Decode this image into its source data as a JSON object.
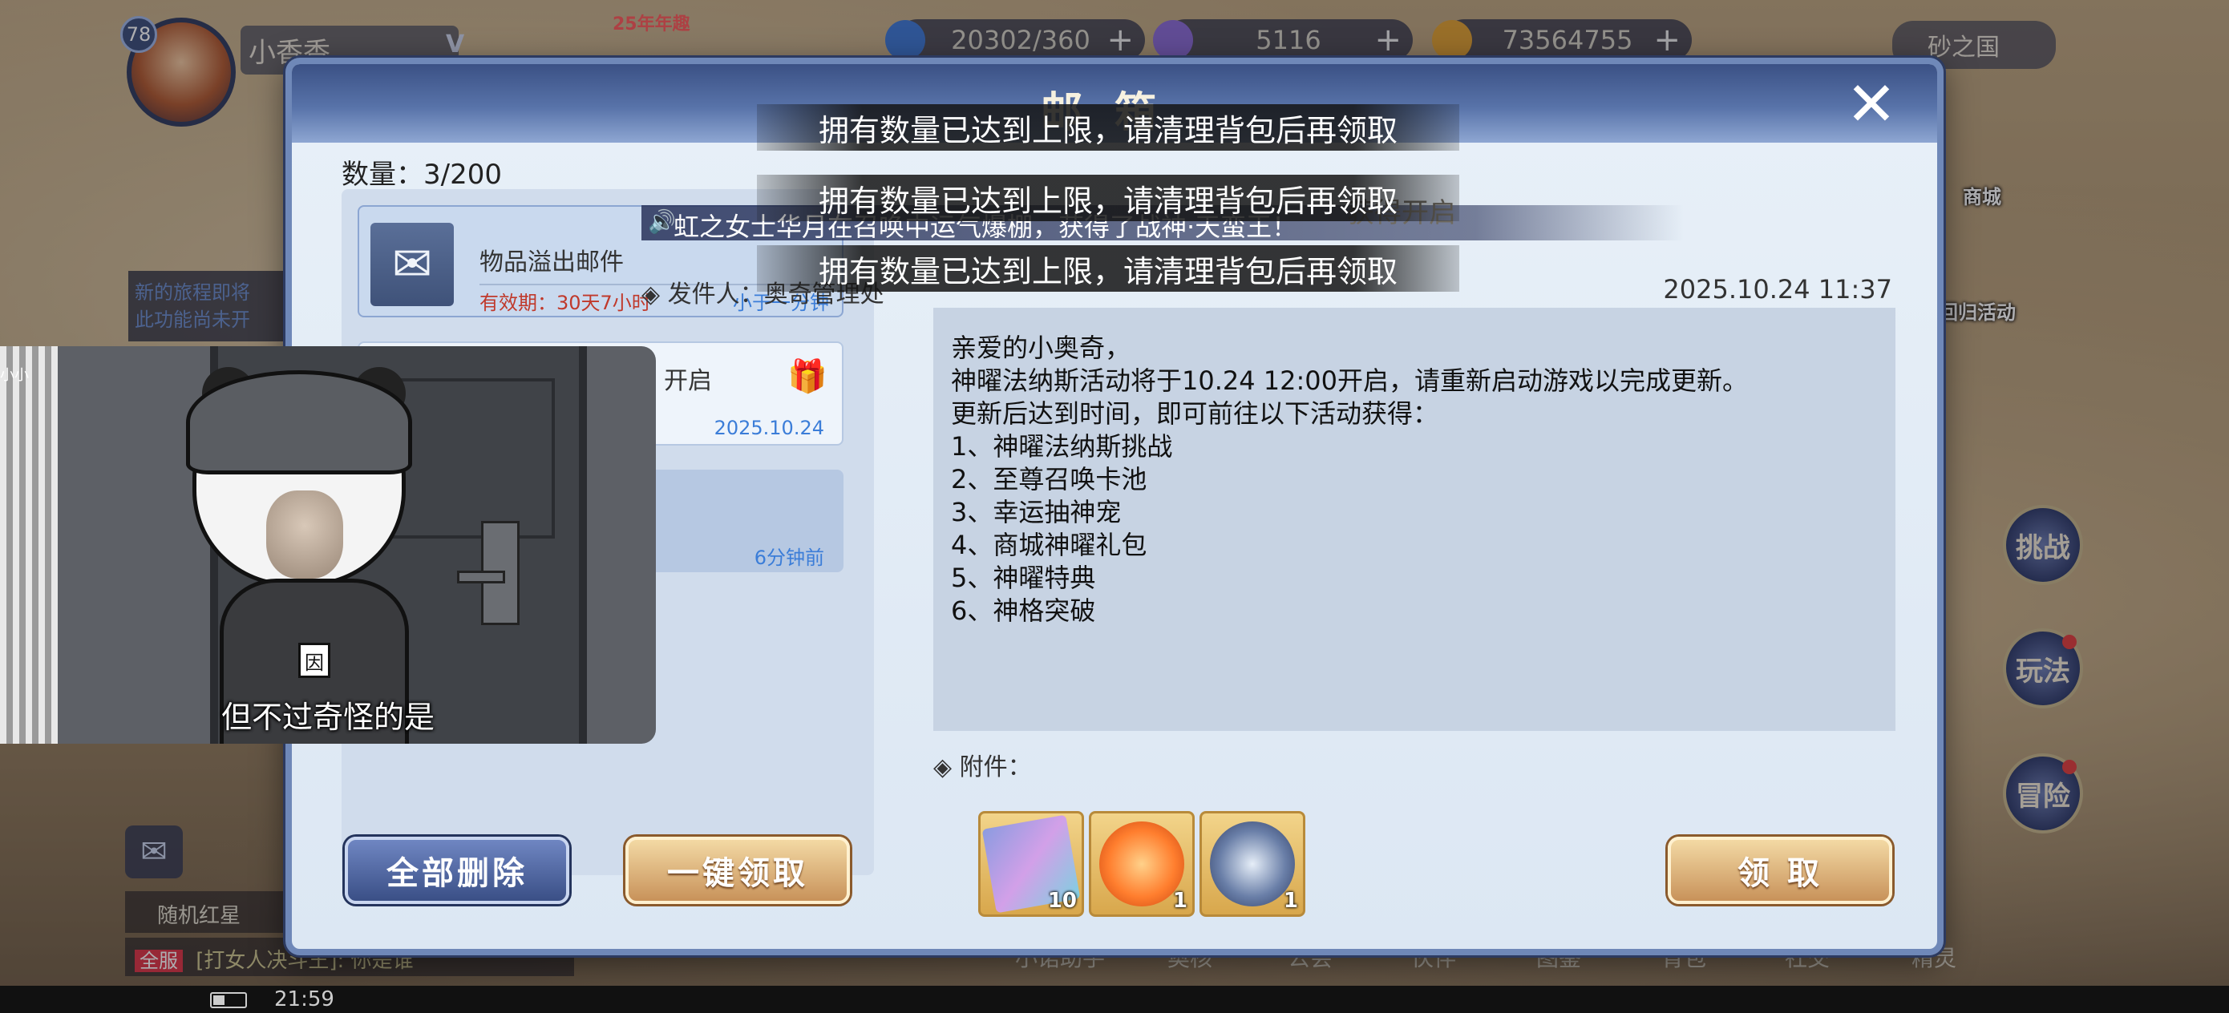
{
  "hud": {
    "level": "78",
    "player_name": "小香香",
    "vip": "V",
    "event_badge": "25年年趣",
    "resources": [
      {
        "value": "20302/360",
        "icon": "stamina-icon",
        "color": "#3e78d6"
      },
      {
        "value": "5116",
        "icon": "diamond-icon",
        "color": "#8a6ad6"
      },
      {
        "value": "73564755",
        "icon": "gold-coin-icon",
        "color": "#e0a030"
      }
    ],
    "plus": "+",
    "region": "砂之国",
    "shop_label": "商城",
    "return_event_label": "回归活动",
    "side_buttons": [
      "挑战",
      "玩法",
      "冒险"
    ],
    "bottom_nav": [
      "小诺助手",
      "奥核",
      "公会",
      "伙伴",
      "图鉴",
      "背包",
      "社交",
      "精灵"
    ],
    "left_news": [
      "新的旅程即将",
      "此功能尚未开"
    ],
    "red_envelope": "随机红星",
    "chat_tag": "全服",
    "chat_text": "[打女人决斗王]: 你是谁",
    "clock": "21:59"
  },
  "mailbox": {
    "title": "邮箱",
    "close": "✕",
    "count_label": "数量：3/200",
    "mails": [
      {
        "title": "物品溢出邮件",
        "expiry_label": "有效期：",
        "expiry_value": "30天7小时",
        "time": "小于一分钟"
      },
      {
        "title": "开启",
        "date": "2025.10.24"
      },
      {
        "time": "6分钟前"
      }
    ],
    "sender": "◈ 发件人：奥奇管理处",
    "date": "2025.10.24  11:37",
    "body_lines": [
      "亲爱的小奥奇，",
      "神曜法纳斯活动将于10.24 12:00开启，请重新启动游戏以完成更新。",
      "更新后达到时间，即可前往以下活动获得：",
      "1、神曜法纳斯挑战",
      "2、至尊召唤卡池",
      "3、幸运抽神宠",
      "4、商城神曜礼包",
      "5、神曜特典",
      "6、神格突破"
    ],
    "attachments_label": "◈ 附件：",
    "attachments": [
      {
        "qty": "10",
        "icon": "summon-ticket-icon"
      },
      {
        "qty": "1",
        "icon": "fire-pet-icon"
      },
      {
        "qty": "1",
        "icon": "sword-badge-icon"
      }
    ],
    "buttons": {
      "delete_all": "全部删除",
      "claim_all": "一键领取",
      "claim": "领 取"
    }
  },
  "marquee": {
    "text": "虹之女士华月在召唤中运气爆棚，获得了战神·天蛮王！",
    "tail_text": "获得开启"
  },
  "toasts": [
    "拥有数量已达到上限，请清理背包后再领取",
    "拥有数量已达到上限，请清理背包后再领取",
    "拥有数量已达到上限，请清理背包后再领取"
  ],
  "video": {
    "subtitle": "但不过奇怪的是",
    "badge_char": "因",
    "corner_mark": "小小"
  }
}
